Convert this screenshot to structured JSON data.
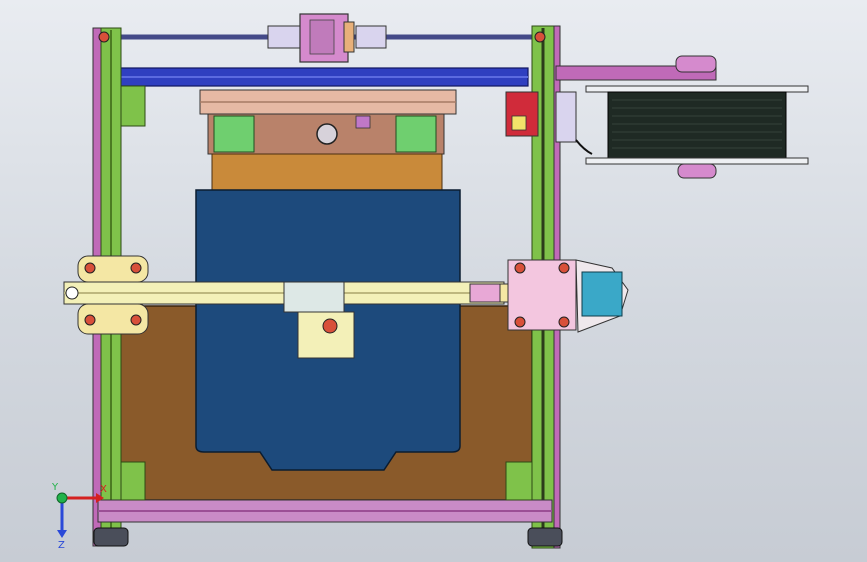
{
  "app": {
    "title": ""
  },
  "model": {
    "colors": {
      "background_top": "#e9ecf1",
      "background_bottom": "#c7ccd4",
      "frame_green": "#7fc24a",
      "frame_magenta": "#c06ab8",
      "rail_blue": "#2f3fc0",
      "bed_blue": "#1d4a7c",
      "plate_brown": "#8a5a2a",
      "carriage_orange": "#c98a3a",
      "beam_yellow": "#f3f0b8",
      "motor_cyan": "#3aa8c8",
      "bracket_pink": "#f3c6df",
      "spool_dark": "#1f2a24"
    }
  },
  "triad": {
    "x_label": "X",
    "y_label": "Y",
    "z_label": "Z"
  }
}
